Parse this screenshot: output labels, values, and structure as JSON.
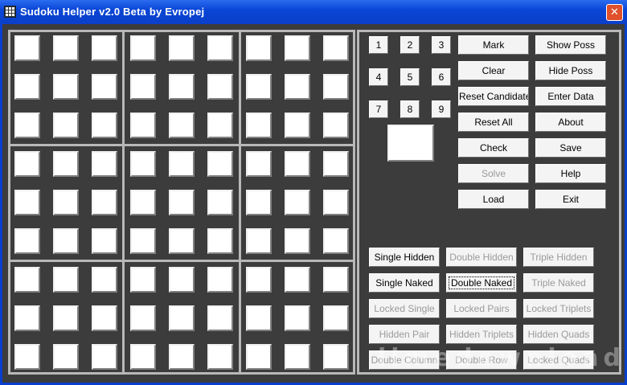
{
  "window": {
    "title": "Sudoku Helper v2.0 Beta by Evropej",
    "close_glyph": "✕"
  },
  "digits": [
    "1",
    "2",
    "3",
    "4",
    "5",
    "6",
    "7",
    "8",
    "9"
  ],
  "controls": [
    {
      "label": "Mark",
      "enabled": true
    },
    {
      "label": "Show Poss",
      "enabled": true
    },
    {
      "label": "Clear",
      "enabled": true
    },
    {
      "label": "Hide Poss",
      "enabled": true
    },
    {
      "label": "Reset Candidate",
      "enabled": true
    },
    {
      "label": "Enter Data",
      "enabled": true
    },
    {
      "label": "Reset All",
      "enabled": true
    },
    {
      "label": "About",
      "enabled": true
    },
    {
      "label": "Check",
      "enabled": true
    },
    {
      "label": "Save",
      "enabled": true
    },
    {
      "label": "Solve",
      "enabled": false
    },
    {
      "label": "Help",
      "enabled": true
    },
    {
      "label": "Load",
      "enabled": true
    },
    {
      "label": "Exit",
      "enabled": true
    }
  ],
  "techniques": [
    {
      "label": "Single Hidden",
      "enabled": true
    },
    {
      "label": "Double Hidden",
      "enabled": false
    },
    {
      "label": "Triple Hidden",
      "enabled": false
    },
    {
      "label": "Single Naked",
      "enabled": true
    },
    {
      "label": "Double Naked",
      "enabled": true,
      "focused": true
    },
    {
      "label": "Triple Naked",
      "enabled": false
    },
    {
      "label": "Locked Single",
      "enabled": false
    },
    {
      "label": "Locked Pairs",
      "enabled": false
    },
    {
      "label": "Locked Triplets",
      "enabled": false
    },
    {
      "label": "Hidden Pair",
      "enabled": false
    },
    {
      "label": "Hidden Triplets",
      "enabled": false
    },
    {
      "label": "Hidden Quads",
      "enabled": false
    },
    {
      "label": "Double Column",
      "enabled": false
    },
    {
      "label": "Double Row",
      "enabled": false
    },
    {
      "label": "Locked Quads",
      "enabled": false
    }
  ],
  "watermark": "limedownload"
}
